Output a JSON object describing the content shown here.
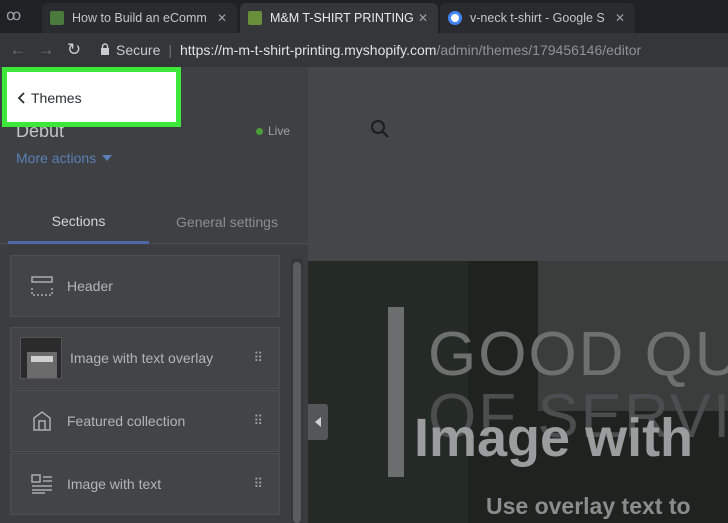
{
  "browser": {
    "tabs": [
      {
        "title": "How to Build an eComm",
        "favicon_color": "#4a7a3c"
      },
      {
        "title": "M&M T-SHIRT PRINTING",
        "favicon_color": "#6a8f3a"
      },
      {
        "title": "v-neck t-shirt - Google S",
        "favicon_color": "#4285f4"
      }
    ],
    "close_glyph": "✕",
    "security_label": "Secure",
    "url_host": "https://m-m-t-shirt-printing.myshopify.com",
    "url_path": "/admin/themes/179456146/editor"
  },
  "editor": {
    "back_label": "Themes",
    "theme_name": "Debut",
    "live_label": "Live",
    "more_actions_label": "More actions",
    "tabs": {
      "sections": "Sections",
      "general": "General settings"
    },
    "sections": [
      {
        "label": "Header",
        "icon": "header-layout-icon"
      },
      {
        "label": "Image with text overlay",
        "icon": "image-thumbnail"
      },
      {
        "label": "Featured collection",
        "icon": "collection-icon"
      },
      {
        "label": "Image with text",
        "icon": "image-text-icon"
      }
    ],
    "drag_glyph": "⠿"
  },
  "preview": {
    "hero_watermark_line1": "GOOD QU",
    "hero_watermark_line2": "OF SERVI",
    "hero_title": "Image with",
    "hero_subtitle": "Use overlay text to"
  }
}
